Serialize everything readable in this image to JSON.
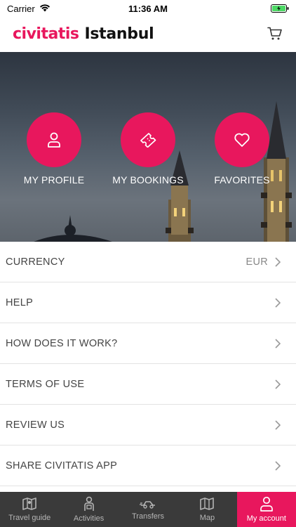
{
  "status": {
    "carrier": "Carrier",
    "time": "11:36 AM"
  },
  "header": {
    "brand": "civitatis",
    "city": "Istanbul"
  },
  "shortcuts": [
    {
      "label": "MY PROFILE",
      "icon": "user-icon"
    },
    {
      "label": "MY BOOKINGS",
      "icon": "ticket-icon"
    },
    {
      "label": "FAVORITES",
      "icon": "heart-icon"
    }
  ],
  "menu": {
    "items": [
      {
        "label": "CURRENCY",
        "value": "EUR"
      },
      {
        "label": "HELP"
      },
      {
        "label": "HOW DOES IT WORK?"
      },
      {
        "label": "TERMS OF USE"
      },
      {
        "label": "REVIEW US"
      },
      {
        "label": "SHARE CIVITATIS APP"
      }
    ]
  },
  "tabs": [
    {
      "label": "Travel guide",
      "icon": "map-book-icon"
    },
    {
      "label": "Activities",
      "icon": "guide-person-icon"
    },
    {
      "label": "Transfers",
      "icon": "car-icon"
    },
    {
      "label": "Map",
      "icon": "map-icon"
    },
    {
      "label": "My account",
      "icon": "user-icon",
      "active": true
    }
  ],
  "colors": {
    "accent": "#e8175d",
    "tabbar": "#3a3a3a"
  }
}
